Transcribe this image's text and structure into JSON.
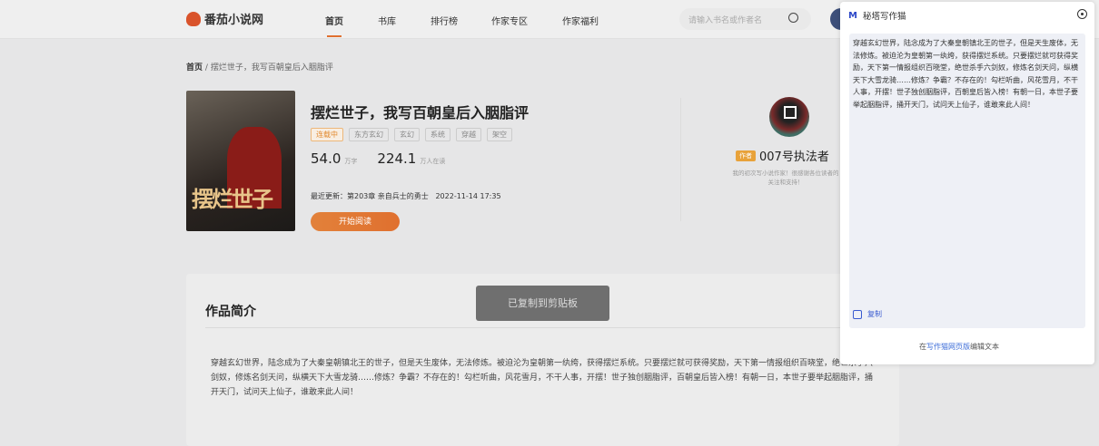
{
  "header": {
    "logo": "番茄小说网",
    "nav": [
      "首页",
      "书库",
      "排行榜",
      "作家专区",
      "作家福利"
    ],
    "search_placeholder": "请输入书名或作者名"
  },
  "breadcrumb": {
    "home": "首页",
    "separator": "/",
    "current": "摆烂世子，我写百朝皇后入胭脂评"
  },
  "book": {
    "cover_title": "摆烂世子",
    "title": "摆烂世子，我写百朝皇后入胭脂评",
    "tags": [
      "连载中",
      "东方玄幻",
      "玄幻",
      "系统",
      "穿越",
      "架空"
    ],
    "word_count": "54.0",
    "word_unit": "万字",
    "readers": "224.1",
    "readers_unit": "万人在读",
    "update_label": "最近更新：",
    "update_chapter": "第203章 亲自兵士的勇士",
    "update_time": "2022-11-14 17:35",
    "read_button": "开始阅读"
  },
  "author": {
    "badge": "作者",
    "name": "007号执法者",
    "bio": "我的初次写小说作家！很感谢各位读者的关注和支持！"
  },
  "intro": {
    "title": "作品简介",
    "text": "穿越玄幻世界，陆念成为了大秦皇朝镇北王的世子，但是天生废体，无法修炼。被迫沦为皇朝第一纨绔，获得摆烂系统。只要摆烂就可获得奖励，天下第一情报组织百晓堂，绝世杀手六剑奴，修炼名剑天问，纵横天下大雪龙骑……修炼？争霸？不存在的！勾栏听曲，风花雪月，不干人事，开摆！世子独创胭脂评，百朝皇后皆入榜！有朝一日，本世子要举起胭脂评，捅开天门，试问天上仙子，谁敢来此人间！"
  },
  "toast": "已复制到剪贴板",
  "panel": {
    "logo": "M",
    "title": "秘塔写作猫",
    "text": "穿越玄幻世界，陆念成为了大秦皇朝镇北王的世子，但是天生废体，无法修炼。被迫沦为皇朝第一纨绔，获得摆烂系统。只要摆烂就可获得奖励，天下第一情报组织百晓堂，绝世杀手六剑奴，修炼名剑天问，纵横天下大雪龙骑……修炼？争霸？不存在的！勾栏听曲，风花雪月，不干人事，开摆！世子独创胭脂评，百朝皇后皆入榜！有朝一日，本世子要举起胭脂评，捅开天门，试问天上仙子，谁敢来此人间！",
    "copy": "复制",
    "footer_pre": "在",
    "footer_link": "写作猫网页版",
    "footer_post": "编辑文本"
  }
}
